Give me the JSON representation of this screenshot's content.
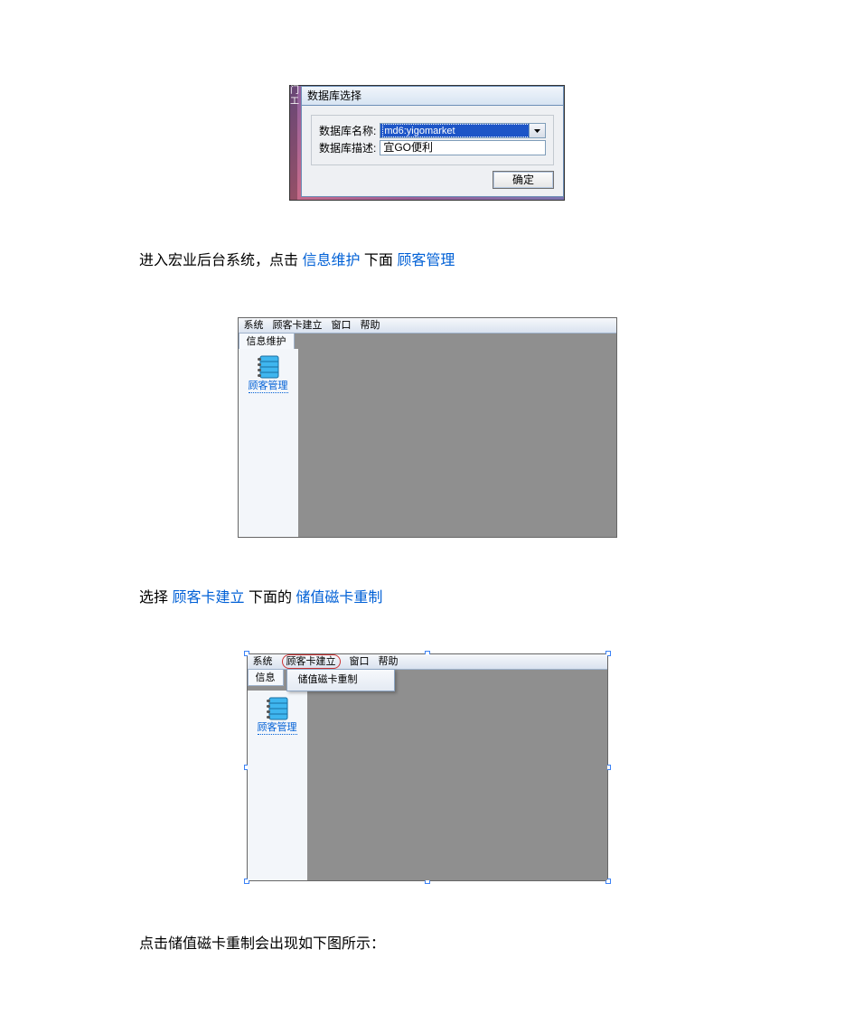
{
  "dialog1": {
    "title": "数据库选择",
    "name_label": "数据库名称:",
    "name_value": "md6:yigomarket",
    "desc_label": "数据库描述:",
    "desc_value": "宜GO便利",
    "ok": "确定",
    "left_edge": "门\n\n\n工"
  },
  "para1": {
    "t1": "进入宏业后台系统，点击 ",
    "link1": "信息维护",
    "t2": "  下面  ",
    "link2": "顾客管理"
  },
  "app1": {
    "menu": {
      "m1": "系统",
      "m2": "顾客卡建立",
      "m3": "窗口",
      "m4": "帮助"
    },
    "tab": "信息维护",
    "sidebar_label": "顾客管理"
  },
  "para2": {
    "t1": "选择",
    "link1": "顾客卡建立",
    "t2": "下面的",
    "link2": "储值磁卡重制"
  },
  "app2": {
    "menu": {
      "m1": "系统",
      "m2": "顾客卡建立",
      "m3": "窗口",
      "m4": "帮助"
    },
    "tab": "信息",
    "dropdown_item": "储值磁卡重制",
    "sidebar_label": "顾客管理"
  },
  "para3": "点击储值磁卡重制会出现如下图所示："
}
